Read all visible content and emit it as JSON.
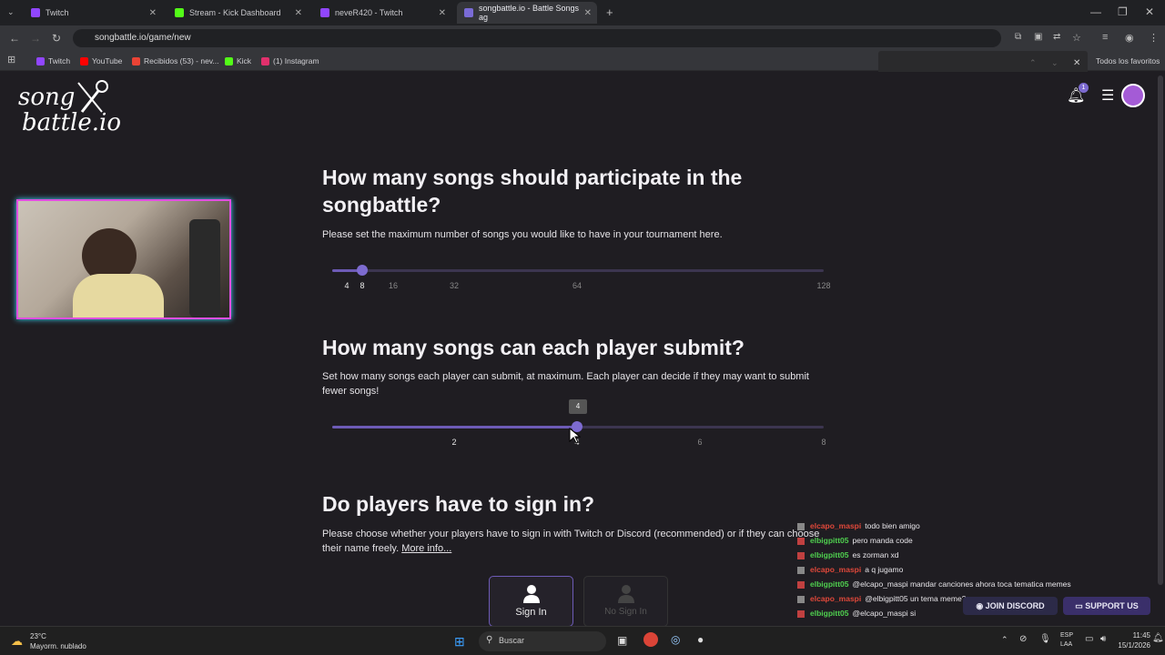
{
  "browser": {
    "tabs": [
      {
        "label": "Twitch",
        "color": "#9146ff"
      },
      {
        "label": "Stream - Kick Dashboard",
        "color": "#53fc18"
      },
      {
        "label": "neveR420 - Twitch",
        "color": "#9146ff"
      },
      {
        "label": "songbattle.io - Battle Songs ag",
        "color": "#7a6bd6"
      }
    ],
    "url": "songbattle.io/game/new",
    "bookmarks": [
      {
        "label": "Twitch",
        "color": "#9146ff"
      },
      {
        "label": "YouTube",
        "color": "#ff0000"
      },
      {
        "label": "Recibidos (53) - nev...",
        "color": "#ea4335"
      },
      {
        "label": "Kick",
        "color": "#53fc18"
      },
      {
        "label": "(1) Instagram",
        "color": "#e1306c"
      }
    ],
    "favorites_label": "Todos los favoritos"
  },
  "header": {
    "logo_line1": "song",
    "logo_line2": "battle.io",
    "notification_count": "1"
  },
  "q1": {
    "title": "How many songs should participate in the songbattle?",
    "desc": "Please set the maximum number of songs you would like to have in your tournament here.",
    "ticks": [
      "4",
      "8",
      "16",
      "32",
      "64",
      "128"
    ],
    "selected_value": 8
  },
  "q2": {
    "title": "How many songs can each player submit?",
    "desc": "Set how many songs each player can submit, at maximum. Each player can decide if they may want to submit fewer songs!",
    "ticks": [
      "2",
      "4",
      "6",
      "8"
    ],
    "tooltip": "4",
    "selected_value": 4
  },
  "q3": {
    "title": "Do players have to sign in?",
    "desc": "Please choose whether your players have to sign in with Twitch or Discord (recommended) or if they can choose their name freely.",
    "more_info": "More info...",
    "sign_in": "Sign In",
    "no_sign_in": "No Sign In"
  },
  "chat": [
    {
      "user": "elcapo_maspi",
      "color": "#e0483a",
      "msg": "todo bien amigo"
    },
    {
      "user": "elbigpitt05",
      "color": "#4fd04f",
      "msg": "pero manda code"
    },
    {
      "user": "elbigpitt05",
      "color": "#4fd04f",
      "msg": "es zorman xd"
    },
    {
      "user": "elcapo_maspi",
      "color": "#e0483a",
      "msg": "a q jugamo"
    },
    {
      "user": "elbigpitt05",
      "color": "#4fd04f",
      "msg": "@elcapo_maspi mandar canciones ahora toca tematica memes"
    },
    {
      "user": "elcapo_maspi",
      "color": "#e0483a",
      "msg": "@elbigpitt05 un tema meme?"
    },
    {
      "user": "elbigpitt05",
      "color": "#4fd04f",
      "msg": "@elcapo_maspi si"
    }
  ],
  "footer": {
    "discord": "JOIN DISCORD",
    "support": "SUPPORT US"
  },
  "taskbar": {
    "weather_temp": "23°C",
    "weather_desc": "Mayorm. nublado",
    "search": "Buscar",
    "lang1": "ESP",
    "lang2": "LAA",
    "time": "11:45",
    "date": "15/1/2026"
  }
}
